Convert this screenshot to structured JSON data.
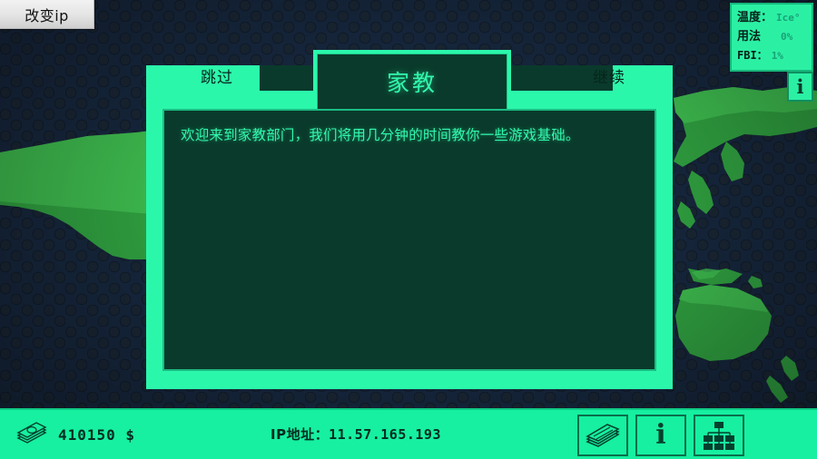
{
  "topbar": {
    "change_ip_label": "改变ip"
  },
  "hud": {
    "rows": [
      {
        "label": "温度：",
        "value": "Ice°",
        "name": "temperature"
      },
      {
        "label": "用法",
        "value": "0%",
        "name": "usage"
      },
      {
        "label": "FBI：",
        "value": "1%",
        "name": "fbi"
      }
    ],
    "info_glyph": "i"
  },
  "dialog": {
    "title": "家教",
    "skip_label": "跳过",
    "continue_label": "继续",
    "body_text": "欢迎来到家教部门，我们将用几分钟的时间教你一些游戏基础。"
  },
  "statusbar": {
    "money": "410150 $",
    "ip_label": "IP地址：",
    "ip_value": "11.57.165.193",
    "info_glyph": "i"
  },
  "colors": {
    "accent_green": "#2bf7ab",
    "bar_green": "#16f0a0",
    "panel_dark": "#0a3a2b",
    "bg_navy": "#16263c",
    "map_green": "#2f9e3f"
  }
}
